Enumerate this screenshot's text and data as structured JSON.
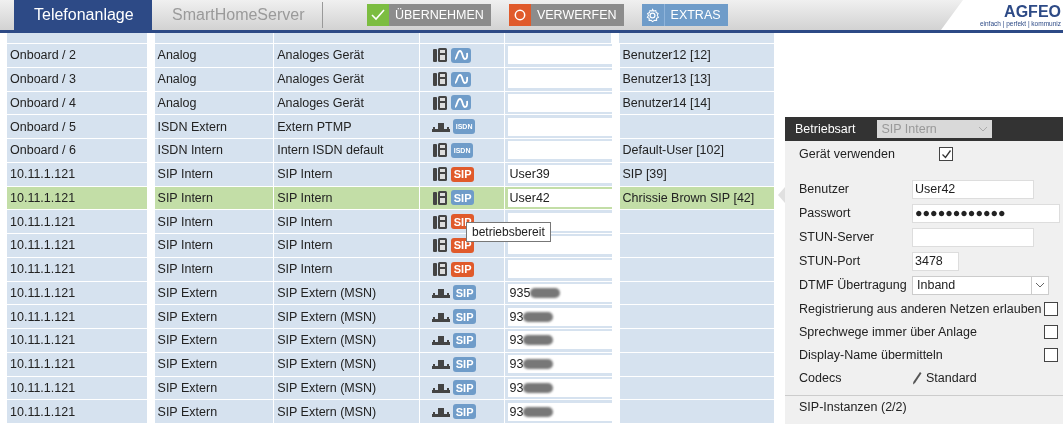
{
  "tabs": [
    {
      "label": "Telefonanlage",
      "selected": true
    },
    {
      "label": "SmartHomeServer",
      "selected": false
    }
  ],
  "toolbar": [
    {
      "kind": "apply",
      "label": "ÜBERNEHMEN"
    },
    {
      "kind": "discard",
      "label": "VERWERFEN"
    },
    {
      "kind": "extras",
      "label": "EXTRAS"
    }
  ],
  "logo": {
    "name": "AGFEO",
    "tagline": "einfach | perfekt | kommuniz"
  },
  "rows": [
    {
      "port": "Onboard / 2",
      "type": "Analog",
      "profile": "Analoges Gerät",
      "kind": "phone",
      "badge": {
        "kind": "analog",
        "color": "#6f9cc9"
      },
      "user": "Benutzer12 [12]",
      "selected": false
    },
    {
      "port": "Onboard / 3",
      "type": "Analog",
      "profile": "Analoges Gerät",
      "kind": "phone",
      "badge": {
        "kind": "analog",
        "color": "#6f9cc9"
      },
      "user": "Benutzer13 [13]",
      "selected": false
    },
    {
      "port": "Onboard / 4",
      "type": "Analog",
      "profile": "Analoges Gerät",
      "kind": "phone",
      "badge": {
        "kind": "analog",
        "color": "#6f9cc9"
      },
      "user": "Benutzer14 [14]",
      "selected": false
    },
    {
      "port": "Onboard / 5",
      "type": "ISDN Extern",
      "profile": "Extern PTMP",
      "kind": "ntba",
      "badge": {
        "kind": "text",
        "label": "ISDN",
        "color": "#6f9cc9"
      },
      "selected": false
    },
    {
      "port": "Onboard / 6",
      "type": "ISDN Intern",
      "profile": "Intern ISDN default",
      "kind": "phone",
      "badge": {
        "kind": "text",
        "label": "ISDN",
        "color": "#6f9cc9"
      },
      "user": "Default-User [102]",
      "selected": false
    },
    {
      "port": "10.11.1.121",
      "type": "SIP Intern",
      "profile": "SIP Intern",
      "kind": "phone",
      "badge": {
        "kind": "text",
        "label": "SIP",
        "color": "#e05a2b"
      },
      "number": "User39",
      "user": "SIP [39]",
      "selected": false
    },
    {
      "port": "10.11.1.121",
      "type": "SIP Intern",
      "profile": "SIP Intern",
      "kind": "phone",
      "badge": {
        "kind": "text",
        "label": "SIP",
        "color": "#6f9cc9"
      },
      "number": "User42",
      "user": "Chrissie Brown SIP [42]",
      "selected": true
    },
    {
      "port": "10.11.1.121",
      "type": "SIP Intern",
      "profile": "SIP Intern",
      "kind": "phone",
      "badge": {
        "kind": "text",
        "label": "SIP",
        "color": "#e05a2b"
      },
      "selected": false
    },
    {
      "port": "10.11.1.121",
      "type": "SIP Intern",
      "profile": "SIP Intern",
      "kind": "phone",
      "badge": {
        "kind": "text",
        "label": "SIP",
        "color": "#e05a2b"
      },
      "selected": false
    },
    {
      "port": "10.11.1.121",
      "type": "SIP Intern",
      "profile": "SIP Intern",
      "kind": "phone",
      "badge": {
        "kind": "text",
        "label": "SIP",
        "color": "#e05a2b"
      },
      "selected": false
    },
    {
      "port": "10.11.1.121",
      "type": "SIP Extern",
      "profile": "SIP Extern (MSN)",
      "kind": "ntba",
      "badge": {
        "kind": "text",
        "label": "SIP",
        "color": "#6f9cc9"
      },
      "number": "935",
      "redacted": true,
      "selected": false
    },
    {
      "port": "10.11.1.121",
      "type": "SIP Extern",
      "profile": "SIP Extern (MSN)",
      "kind": "ntba",
      "badge": {
        "kind": "text",
        "label": "SIP",
        "color": "#6f9cc9"
      },
      "number": "93",
      "redacted": true,
      "selected": false
    },
    {
      "port": "10.11.1.121",
      "type": "SIP Extern",
      "profile": "SIP Extern (MSN)",
      "kind": "ntba",
      "badge": {
        "kind": "text",
        "label": "SIP",
        "color": "#6f9cc9"
      },
      "number": "93",
      "redacted": true,
      "selected": false
    },
    {
      "port": "10.11.1.121",
      "type": "SIP Extern",
      "profile": "SIP Extern (MSN)",
      "kind": "ntba",
      "badge": {
        "kind": "text",
        "label": "SIP",
        "color": "#6f9cc9"
      },
      "number": "93",
      "redacted": true,
      "selected": false
    },
    {
      "port": "10.11.1.121",
      "type": "SIP Extern",
      "profile": "SIP Extern (MSN)",
      "kind": "ntba",
      "badge": {
        "kind": "text",
        "label": "SIP",
        "color": "#6f9cc9"
      },
      "number": "93",
      "redacted": true,
      "selected": false
    },
    {
      "port": "10.11.1.121",
      "type": "SIP Extern",
      "profile": "SIP Extern (MSN)",
      "kind": "ntba",
      "badge": {
        "kind": "text",
        "label": "SIP",
        "color": "#6f9cc9"
      },
      "number": "93",
      "redacted": true,
      "selected": false
    }
  ],
  "tooltip": "betriebsbereit",
  "panel": {
    "mode_label": "Betriebsart",
    "mode_value": "SIP Intern",
    "mode_disabled": true,
    "fields": [
      {
        "kind": "checkbox",
        "label": "Gerät verwenden",
        "checked": true
      },
      {
        "kind": "text",
        "label": "Benutzer",
        "value": "User42"
      },
      {
        "kind": "password",
        "label": "Passwort",
        "value": "●●●●●●●●●●●●"
      },
      {
        "kind": "text",
        "label": "STUN-Server"
      },
      {
        "kind": "number",
        "label": "STUN-Port",
        "value": "3478"
      },
      {
        "kind": "select",
        "label": "DTMF Übertragung",
        "value": "Inband"
      },
      {
        "kind": "option",
        "label": "Registrierung aus anderen Netzen erlauben",
        "checked": false
      },
      {
        "kind": "option",
        "label": "Sprechwege immer über Anlage",
        "checked": false
      },
      {
        "kind": "option",
        "label": "Display-Name übermitteln",
        "checked": false
      },
      {
        "kind": "edit",
        "label": "Codecs",
        "value": "Standard"
      }
    ],
    "section": "SIP-Instanzen (2/2)"
  }
}
